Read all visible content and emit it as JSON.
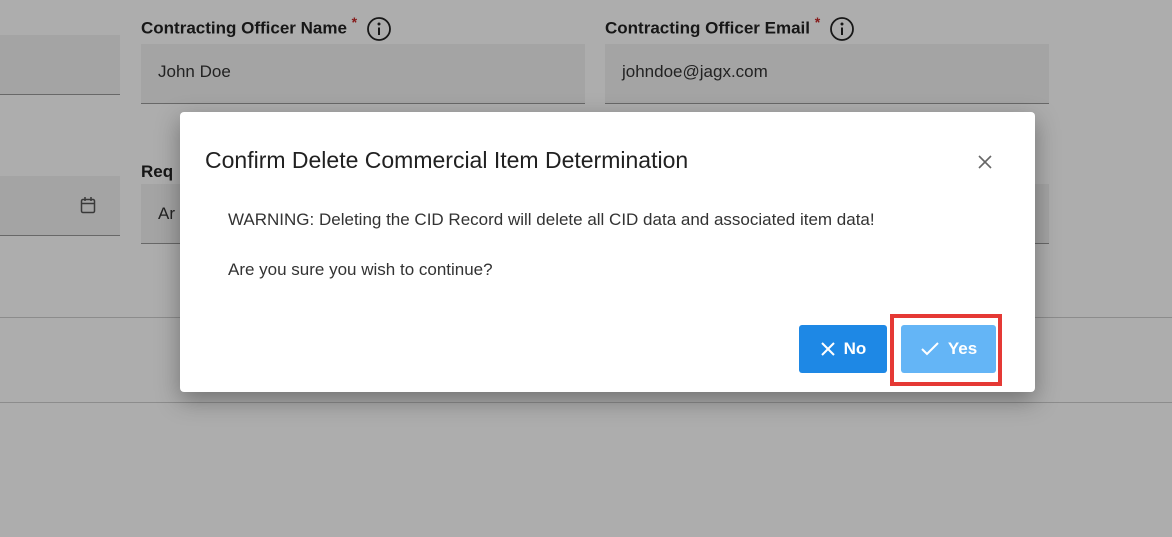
{
  "form": {
    "officer_name_label": "Contracting Officer Name",
    "officer_name_value": "John Doe",
    "officer_email_label": "Contracting Officer Email",
    "officer_email_value": "johndoe@jagx.com",
    "required_mark": "*",
    "partial_label": "Req",
    "partial_value": "Ar"
  },
  "dialog": {
    "title": "Confirm Delete Commercial Item Determination",
    "warning": "WARNING: Deleting the CID Record will delete all CID data and associated item data!",
    "confirm_text": "Are you sure you wish to continue?",
    "no_label": "No",
    "yes_label": "Yes"
  },
  "icons": {
    "info": "info-icon",
    "calendar": "calendar-icon",
    "close": "close-icon",
    "no": "x-icon",
    "yes": "checkmark-icon"
  },
  "colors": {
    "primary": "#1e88e5",
    "primary_light": "#64b5f6",
    "highlight": "#e53935",
    "required": "#c62828"
  }
}
